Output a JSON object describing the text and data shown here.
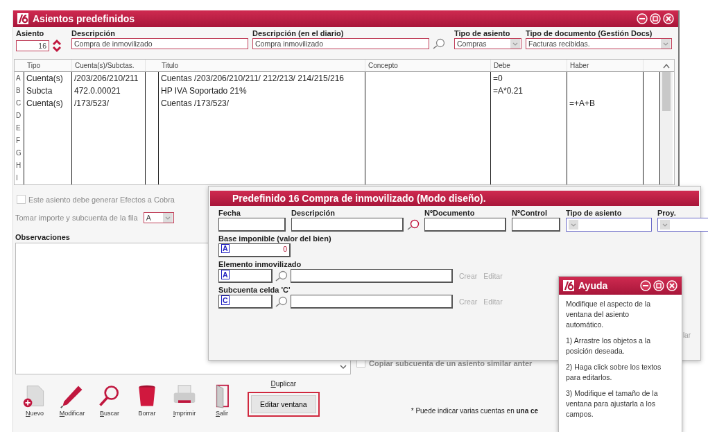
{
  "main_window": {
    "title": "Asientos predefinidos",
    "header_fields": [
      {
        "label": "Asiento",
        "value": "16",
        "kind": "number"
      },
      {
        "label": "Descripción",
        "value": "Compra de inmovilizado",
        "kind": "text"
      },
      {
        "label": "Descripción (en el diario)",
        "value": "Compra inmovilizado",
        "kind": "lookup"
      },
      {
        "label": "Tipo de asiento",
        "value": "Compras",
        "kind": "select"
      },
      {
        "label": "Tipo de documento (Gestión Docs)",
        "value": "Facturas recibidas.",
        "kind": "select"
      }
    ],
    "table": {
      "columns": [
        "Tipo",
        "Cuenta(s)/Subctas.",
        "Titulo",
        "Concepto",
        "Debe",
        "Haber"
      ],
      "rows": [
        {
          "letter": "A",
          "tipo": "Cuenta(s)",
          "cuenta": "/203/206/210/211",
          "titulo": "Cuentas /203/206/210/211/ 212/213/ 214/215/216",
          "debe": "=0"
        },
        {
          "letter": "B",
          "tipo": "Subcta",
          "cuenta": "472.0.00021",
          "titulo": "HP IVA Soportado 21%",
          "debe": "=A*0.21"
        },
        {
          "letter": "C",
          "tipo": "Cuenta(s)",
          "cuenta": "/173/523/",
          "titulo": "Cuentas /173/523/",
          "haber": "=+A+B"
        },
        {
          "letter": "D"
        },
        {
          "letter": "E"
        },
        {
          "letter": "F"
        },
        {
          "letter": "G"
        },
        {
          "letter": "H"
        },
        {
          "letter": "I"
        }
      ]
    },
    "effects_checkbox": {
      "label": "Este asiento debe generar Efectos a Cobra",
      "checked": false
    },
    "row_picker": {
      "label": "Tomar importe y subcuenta de la fila",
      "value": "A"
    },
    "observaciones": {
      "label": "Observaciones"
    },
    "copy_checkbox": {
      "label": "Copiar subcuenta de un asiento similar anter",
      "checked": false
    },
    "toolbar": [
      {
        "label": "Nuevo",
        "kind": "new",
        "underline_first": true
      },
      {
        "label": "Modificar",
        "kind": "pen",
        "underline_first": true
      },
      {
        "label": "Buscar",
        "kind": "search",
        "underline_first": true
      },
      {
        "label": "Borrar",
        "kind": "bin",
        "underline_first": false
      },
      {
        "label": "Imprimir",
        "kind": "printer",
        "underline_first": true
      },
      {
        "label": "Salir",
        "kind": "door",
        "underline_first": true
      }
    ],
    "duplicate_link": {
      "label": "Duplicar",
      "underline_first": true
    },
    "edit_button": {
      "label": "Editar ventana",
      "highlighted": true
    },
    "note": "* Puede indicar varias cuentas en **una ce**"
  },
  "design_window": {
    "title": "Predefinido 16 Compra de inmovilizado (Modo diseño).",
    "top_fields": [
      {
        "label": "Fecha",
        "kind": "text"
      },
      {
        "label": "Descripción",
        "kind": "lookup"
      },
      {
        "label": "NºDocumento",
        "kind": "text"
      },
      {
        "label": "NºControl",
        "kind": "text"
      },
      {
        "label": "Tipo de asiento",
        "kind": "select"
      },
      {
        "label": "Proy.",
        "kind": "select"
      }
    ],
    "sections": [
      {
        "label": "Base imponible (valor del bien)",
        "cell": "A",
        "value": "0",
        "kind": "amount"
      },
      {
        "label": "Elemento inmovilizado",
        "cell": "A",
        "kind": "account",
        "actions": [
          "Crear",
          "Editar"
        ]
      },
      {
        "label": "Subcuenta celda 'C'",
        "cell": "C",
        "kind": "account",
        "actions": [
          "Crear",
          "Editar"
        ]
      }
    ],
    "cut_text": "lar"
  },
  "help_window": {
    "title": "Ayuda",
    "paragraphs": [
      "Modifique el aspecto de la ventana del  asiento automático.",
      "1) Arrastre los objetos a la posición deseada.",
      "2) Haga click sobre los textos para editarlos.",
      "3) Modifique el tamaño de la ventana para ajustarla a los campos."
    ]
  }
}
